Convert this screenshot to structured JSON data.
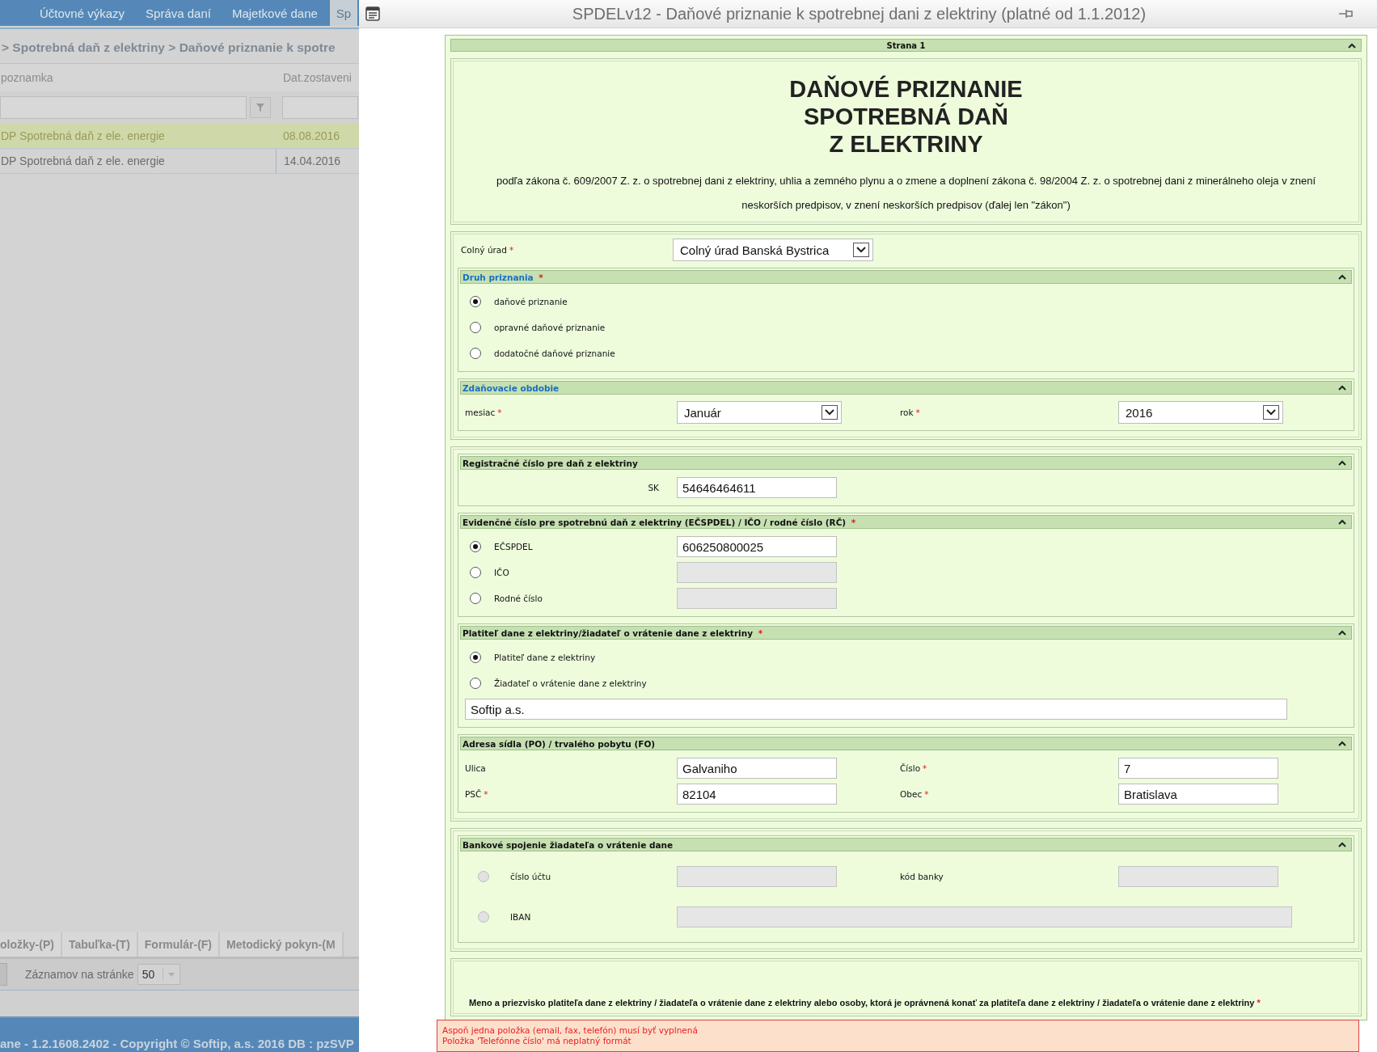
{
  "background_app": {
    "nav_tabs": [
      {
        "label": "Účtovné výkazy",
        "selected": false
      },
      {
        "label": "Správa daní",
        "selected": false
      },
      {
        "label": "Majetkové dane",
        "selected": false
      },
      {
        "label": "Sp",
        "selected": true
      }
    ],
    "breadcrumb": "> Spotrebná daň z elektriny > Daňové priznanie k spotre",
    "columns": [
      "poznamka",
      "Dat.zostaveni"
    ],
    "rows": [
      {
        "cells": [
          "DP Spotrebná daň z ele. energie",
          "08.08.2016"
        ],
        "selected": true
      },
      {
        "cells": [
          "DP Spotrebná daň z ele. energie",
          "14.04.2016"
        ],
        "selected": false
      }
    ],
    "bottom_tabs": [
      "oložky-(P)",
      "Tabuľka-(T)",
      "Formulár-(F)",
      "Metodický pokyn-(M"
    ],
    "pager": {
      "label": "Záznamov na stránke",
      "value": "50"
    },
    "footer": "ane - 1.2.1608.2402 - Copyright © Softip, a.s. 2016 DB : pzSVP"
  },
  "dialog": {
    "title": "SPDELv12 - Daňové priznanie k spotrebnej dani z elektriny (platné od 1.1.2012)",
    "page_header": "Strana 1",
    "heading": [
      "DAŇOVÉ PRIZNANIE",
      "SPOTREBNÁ DAŇ",
      "Z ELEKTRINY"
    ],
    "legal_note": "podľa zákona č. 609/2007 Z. z. o spotrebnej dani z elektriny, uhlia a zemného plynu a o zmene a doplnení zákona č. 98/2004 Z. z. o spotrebnej dani z minerálneho oleja v znení neskorších predpisov, v znení neskorších predpisov (ďalej len \"zákon\")",
    "required_mark": "*",
    "blocks": [
      {
        "rows": [
          [
            {
              "kind": "label",
              "text": "Colný úrad",
              "required": true
            },
            {
              "kind": "select",
              "value": "Colný úrad Banská Bystrica"
            }
          ]
        ],
        "groups": [
          {
            "title": "Druh priznania",
            "link": true,
            "required": true,
            "rows": [
              [
                {
                  "kind": "radio",
                  "label": "daňové priznanie",
                  "selected": true,
                  "disabled": false
                }
              ],
              [
                {
                  "kind": "radio",
                  "label": "opravné daňové priznanie",
                  "selected": false,
                  "disabled": false
                }
              ],
              [
                {
                  "kind": "radio",
                  "label": "dodatočné daňové priznanie",
                  "selected": false,
                  "disabled": false
                }
              ]
            ]
          },
          {
            "title": "Zdaňovacie obdobie",
            "link": true,
            "required": false,
            "rows": [
              [
                {
                  "kind": "label",
                  "text": "mesiac",
                  "required": true
                },
                {
                  "kind": "select",
                  "value": "Január"
                },
                {
                  "kind": "label",
                  "text": "rok",
                  "required": true
                },
                {
                  "kind": "select",
                  "value": "2016"
                }
              ]
            ]
          }
        ]
      },
      {
        "groups": [
          {
            "title": "Registračné číslo pre daň z elektriny",
            "link": false,
            "required": false,
            "rows": [
              [
                {
                  "kind": "prefix",
                  "text": "SK"
                },
                {
                  "kind": "input",
                  "value": "54646464611",
                  "disabled": false
                }
              ]
            ]
          },
          {
            "title": "Evidenčné číslo pre spotrebnú daň z elektriny (EČSPDEL) / IČO / rodné číslo (RČ)",
            "link": false,
            "required": true,
            "rows": [
              [
                {
                  "kind": "radio",
                  "label": "EČSPDEL",
                  "selected": true,
                  "disabled": false
                },
                {
                  "kind": "input",
                  "value": "606250800025",
                  "disabled": false
                }
              ],
              [
                {
                  "kind": "radio",
                  "label": "IČO",
                  "selected": false,
                  "disabled": false
                },
                {
                  "kind": "input",
                  "disabled": true
                }
              ],
              [
                {
                  "kind": "radio",
                  "label": "Rodné číslo",
                  "selected": false,
                  "disabled": false
                },
                {
                  "kind": "input",
                  "disabled": true
                }
              ]
            ]
          },
          {
            "title": "Platiteľ dane z elektriny/žiadateľ o vrátenie dane z elektriny",
            "link": false,
            "required": true,
            "rows": [
              [
                {
                  "kind": "radio",
                  "label": "Platiteľ dane z elektriny",
                  "selected": true,
                  "disabled": false
                }
              ],
              [
                {
                  "kind": "radio",
                  "label": "Žiadateľ o vrátenie dane z elektriny",
                  "selected": false,
                  "disabled": false
                }
              ],
              [
                {
                  "kind": "full-input",
                  "value": "Softip a.s.",
                  "disabled": false
                }
              ]
            ]
          },
          {
            "title": "Adresa sídla (PO) / trvalého pobytu (FO)",
            "link": false,
            "required": false,
            "rows": [
              [
                {
                  "kind": "label",
                  "text": "Ulica",
                  "required": false
                },
                {
                  "kind": "input",
                  "value": "Galvaniho",
                  "disabled": false
                },
                {
                  "kind": "label",
                  "text": "Číslo",
                  "required": true
                },
                {
                  "kind": "input",
                  "value": "7",
                  "disabled": false
                }
              ],
              [
                {
                  "kind": "label",
                  "text": "PSČ",
                  "required": true
                },
                {
                  "kind": "input",
                  "value": "82104",
                  "disabled": false
                },
                {
                  "kind": "label",
                  "text": "Obec",
                  "required": true
                },
                {
                  "kind": "input",
                  "value": "Bratislava",
                  "disabled": false
                }
              ]
            ]
          }
        ]
      },
      {
        "groups": [
          {
            "title": "Bankové spojenie žiadateľa o vrátenie dane",
            "link": false,
            "required": false,
            "rows": [
              [
                {
                  "kind": "radio",
                  "label": "číslo účtu",
                  "selected": false,
                  "disabled": true
                },
                {
                  "kind": "input",
                  "disabled": true
                },
                {
                  "kind": "label",
                  "text": "kód banky",
                  "required": false
                },
                {
                  "kind": "input",
                  "disabled": true
                }
              ],
              [
                {
                  "kind": "radio",
                  "label": "IBAN",
                  "selected": false,
                  "disabled": true
                },
                {
                  "kind": "long-input",
                  "disabled": true
                }
              ]
            ]
          }
        ]
      },
      {
        "rows": [
          [
            {
              "kind": "note",
              "text": "Meno a priezvisko platiteľa dane z elektriny / žiadateľa o vrátenie dane z elektriny alebo osoby, ktorá je oprávnená konať za platiteľa dane z elektriny / žiadateľa o vrátenie dane z elektriny",
              "required": true
            }
          ]
        ]
      }
    ],
    "errors": [
      "Aspoň jedna položka (email, fax, telefón) musí byť vyplnená",
      "Položka 'Telefónne číslo' má neplatný formát"
    ]
  }
}
